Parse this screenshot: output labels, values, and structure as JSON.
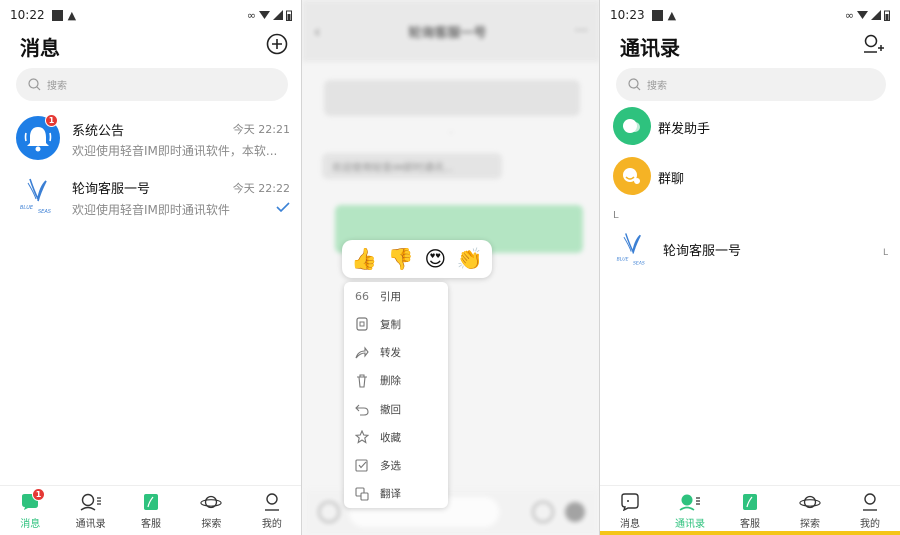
{
  "screen1": {
    "status_time": "10:22",
    "title": "消息",
    "search_placeholder": "搜索",
    "chats": [
      {
        "name": "系统公告",
        "time": "今天 22:21",
        "preview": "欢迎使用轻音IM即时通讯软件，本软...",
        "badge": "1"
      },
      {
        "name": "轮询客服一号",
        "time": "今天 22:22",
        "preview": "欢迎使用轻音IM即时通讯软件"
      }
    ],
    "tabs": [
      {
        "label": "消息",
        "badge": "1"
      },
      {
        "label": "通讯录"
      },
      {
        "label": "客服"
      },
      {
        "label": "探索"
      },
      {
        "label": "我的"
      }
    ]
  },
  "screen2": {
    "title": "轮询客服一号",
    "bubble_left": "欢迎使用轻音IM即时通讯...",
    "reactions": [
      "👍",
      "👎",
      "😍",
      "👏"
    ],
    "menu": [
      {
        "label": "引用",
        "icon": "quote-icon"
      },
      {
        "label": "复制",
        "icon": "copy-icon"
      },
      {
        "label": "转发",
        "icon": "forward-icon"
      },
      {
        "label": "删除",
        "icon": "trash-icon"
      },
      {
        "label": "撤回",
        "icon": "undo-icon"
      },
      {
        "label": "收藏",
        "icon": "star-icon"
      },
      {
        "label": "多选",
        "icon": "multiselect-icon"
      },
      {
        "label": "翻译",
        "icon": "translate-icon"
      }
    ]
  },
  "screen3": {
    "status_time": "10:23",
    "title": "通讯录",
    "search_placeholder": "搜索",
    "contacts": [
      {
        "name": "群发助手"
      },
      {
        "name": "群聊"
      }
    ],
    "section_letter": "L",
    "section_contact": "轮询客服一号",
    "index_letter": "L",
    "tabs": [
      {
        "label": "消息"
      },
      {
        "label": "通讯录"
      },
      {
        "label": "客服"
      },
      {
        "label": "探索"
      },
      {
        "label": "我的"
      }
    ]
  },
  "colors": {
    "accent_green": "#2ec27e",
    "badge_red": "#e53935",
    "notice_blue": "#1e7ee6",
    "group_yellow": "#f5b325"
  }
}
